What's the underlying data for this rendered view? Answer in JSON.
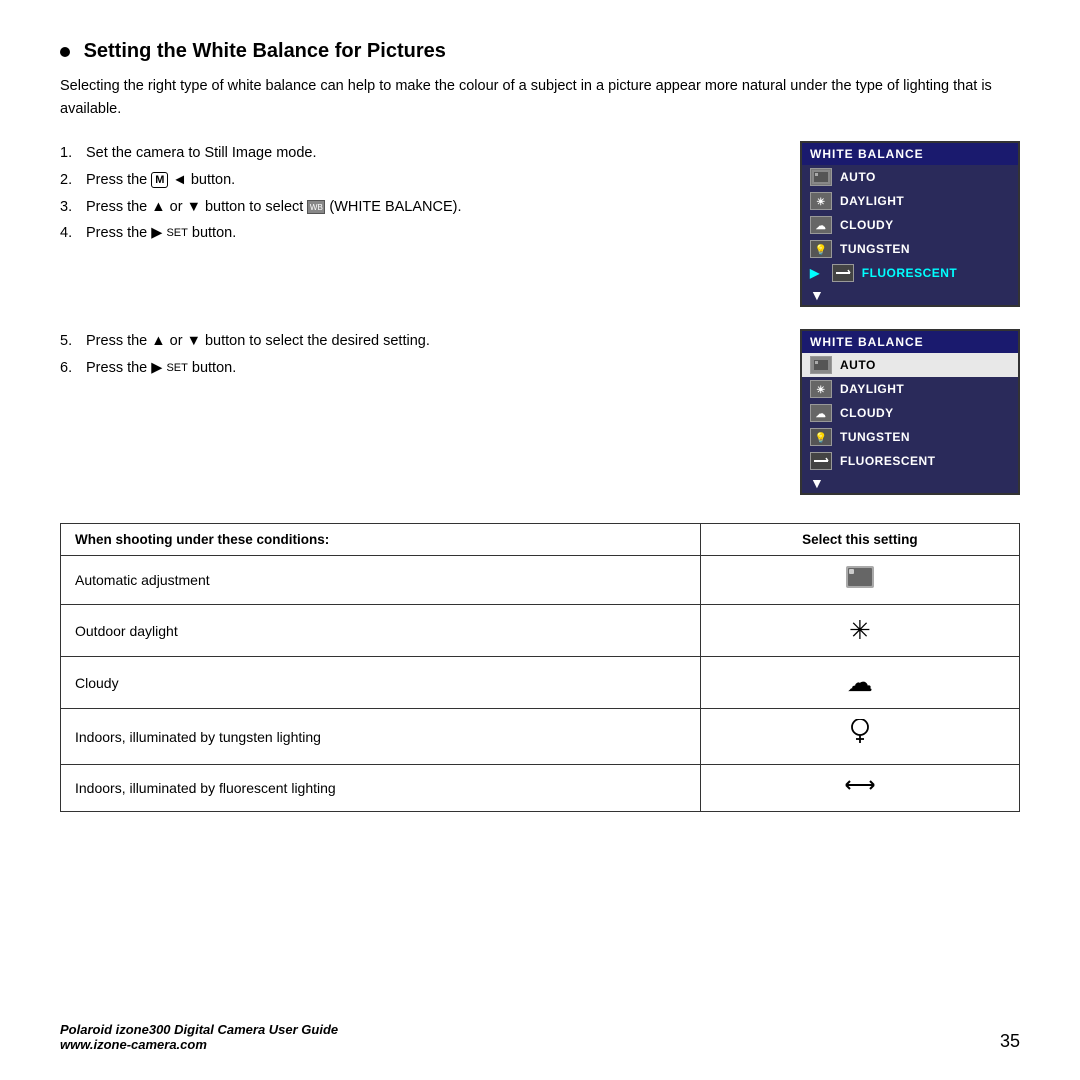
{
  "page": {
    "title": "Setting the White Balance for Pictures",
    "intro": "Selecting the right type of white balance can help to make the colour of a subject in a picture appear more natural under the type of lighting that is available.",
    "steps": [
      {
        "num": "1.",
        "text": "Set the camera to Still Image mode."
      },
      {
        "num": "2.",
        "text": "Press the [M] ◄ button."
      },
      {
        "num": "3.",
        "text": "Press the ▲ or ▼ button to select [WB] (WHITE BALANCE)."
      },
      {
        "num": "4.",
        "text": "Press the ▶ SET button."
      },
      {
        "num": "5.",
        "text": "Press the ▲ or ▼ button to select the desired setting."
      },
      {
        "num": "6.",
        "text": "Press the ▶ SET button."
      }
    ],
    "menu1": {
      "header": "WHITE BALANCE",
      "items": [
        {
          "label": "AUTO",
          "selected": false
        },
        {
          "label": "DAYLIGHT",
          "selected": false
        },
        {
          "label": "CLOUDY",
          "selected": false
        },
        {
          "label": "TUNGSTEN",
          "selected": false
        },
        {
          "label": "FLUORESCENT",
          "selected": true,
          "highlighted": true
        }
      ]
    },
    "menu2": {
      "header": "WHITE BALANCE",
      "items": [
        {
          "label": "AUTO",
          "selected": true
        },
        {
          "label": "DAYLIGHT",
          "selected": false
        },
        {
          "label": "CLOUDY",
          "selected": false
        },
        {
          "label": "TUNGSTEN",
          "selected": false
        },
        {
          "label": "FLUORESCENT",
          "selected": false
        }
      ]
    },
    "table": {
      "col1_header": "When shooting under these conditions:",
      "col2_header": "Select this setting",
      "rows": [
        {
          "condition": "Automatic adjustment",
          "icon": "🔲"
        },
        {
          "condition": "Outdoor daylight",
          "icon": "✳"
        },
        {
          "condition": "Cloudy",
          "icon": "🌥"
        },
        {
          "condition": "Indoors, illuminated by tungsten lighting",
          "icon": "💡"
        },
        {
          "condition": "Indoors, illuminated by fluorescent lighting",
          "icon": "⊣⊢"
        }
      ]
    },
    "footer": {
      "brand": "Polaroid izone300 Digital Camera User Guide",
      "website": "www.izone-camera.com",
      "page_num": "35"
    }
  }
}
